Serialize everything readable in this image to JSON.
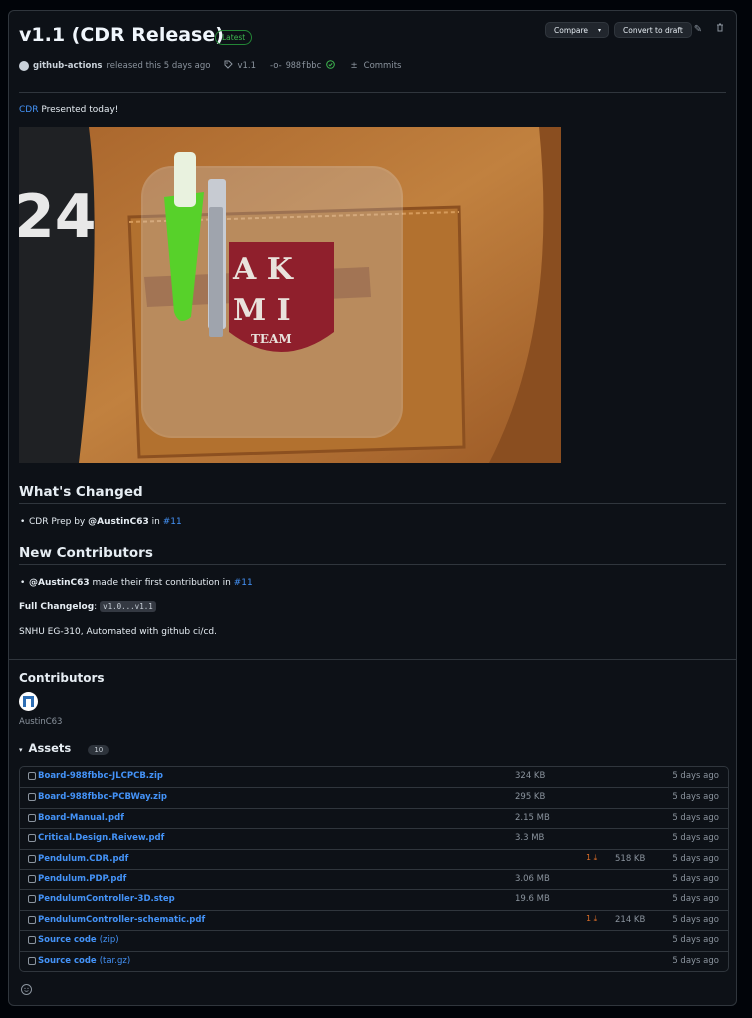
{
  "release": {
    "title": "v1.1 (CDR Release)",
    "badge": "Latest",
    "author": "github-actions",
    "released_text": "released this 5 days ago",
    "tag": "v1.1",
    "commit": "988fbbc",
    "commits_label": "Commits"
  },
  "toolbar": {
    "compare_label": "Compare",
    "convert_label": "Convert to draft"
  },
  "intro": {
    "link": "CDR",
    "text": "Presented today!"
  },
  "photo": {
    "patch_line1": "A K",
    "patch_line2": "M I",
    "patch_line3": "TEAM",
    "shirt_number": "24"
  },
  "whats_changed": {
    "heading": "What's Changed",
    "items": [
      {
        "text": "CDR Prep by ",
        "user": "@AustinC63",
        "mid": " in ",
        "pr": "#11"
      }
    ]
  },
  "new_contributors": {
    "heading": "New Contributors",
    "items": [
      {
        "user": "@AustinC63",
        "text": " made their first contribution in ",
        "pr": "#11"
      }
    ]
  },
  "changelog": {
    "label": "Full Changelog",
    "range": "v1.0...v1.1"
  },
  "footer_text": "SNHU EG-310, Automated with github ci/cd.",
  "contributors": {
    "heading": "Contributors",
    "names": [
      "AustinC63"
    ]
  },
  "assets": {
    "heading": "Assets",
    "count": "10",
    "rows": [
      {
        "name": "Board-988fbbc-JLCPCB.zip",
        "size": "324 KB",
        "downloads": "",
        "date": "5 days ago"
      },
      {
        "name": "Board-988fbbc-PCBWay.zip",
        "size": "295 KB",
        "downloads": "",
        "date": "5 days ago"
      },
      {
        "name": "Board-Manual.pdf",
        "size": "2.15 MB",
        "downloads": "",
        "date": "5 days ago"
      },
      {
        "name": "Critical.Design.Reivew.pdf",
        "size": "3.3 MB",
        "downloads": "",
        "date": "5 days ago"
      },
      {
        "name": "Pendulum.CDR.pdf",
        "size": "518 KB",
        "downloads": "1",
        "date": "5 days ago"
      },
      {
        "name": "Pendulum.PDP.pdf",
        "size": "3.06 MB",
        "downloads": "",
        "date": "5 days ago"
      },
      {
        "name": "PendulumController-3D.step",
        "size": "19.6 MB",
        "downloads": "",
        "date": "5 days ago"
      },
      {
        "name": "PendulumController-schematic.pdf",
        "size": "214 KB",
        "downloads": "1",
        "date": "5 days ago"
      },
      {
        "name": "Source code",
        "suffix": "(zip)",
        "size": "",
        "downloads": "",
        "date": "5 days ago"
      },
      {
        "name": "Source code",
        "suffix": "(tar.gz)",
        "size": "",
        "downloads": "",
        "date": "5 days ago"
      }
    ]
  },
  "colors": {
    "background": "#0d1117",
    "link": "#4493f8",
    "border": "#30363d",
    "latest_badge": "#3fb950"
  }
}
